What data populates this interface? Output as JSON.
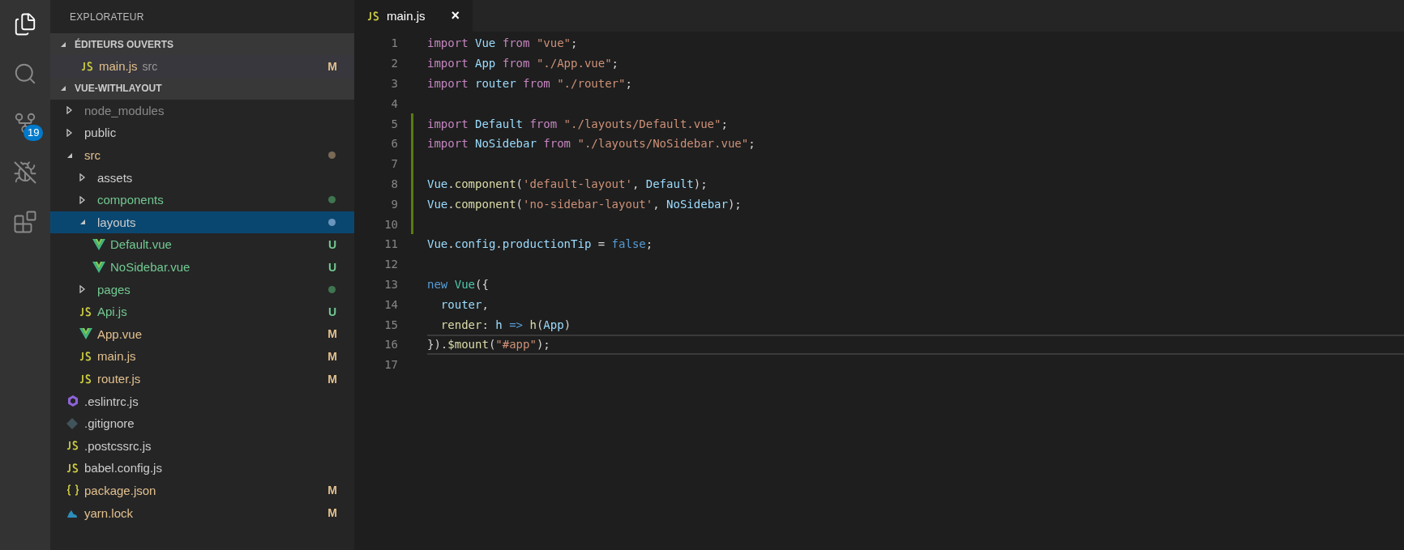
{
  "activity_bar": [
    {
      "kind": "files",
      "selected": true
    },
    {
      "kind": "search",
      "selected": false
    },
    {
      "kind": "branch",
      "selected": false,
      "badge": "19"
    },
    {
      "kind": "debug",
      "selected": false
    },
    {
      "kind": "extensions",
      "selected": false
    }
  ],
  "sidebar": {
    "title": "EXPLORATEUR",
    "open_editors": {
      "title": "ÉDITEURS OUVERTS",
      "expanded": true,
      "items": [
        {
          "kind": "js",
          "name": "main.js",
          "folder": "src",
          "status": "M",
          "modified": true,
          "untracked": false,
          "selected": true
        }
      ]
    },
    "project": {
      "title": "VUE-WITHLAYOUT",
      "expanded": true,
      "items": [
        {
          "kind": "folder",
          "name": "node_modules",
          "expanded": false,
          "ignored": true,
          "modified": false,
          "untracked": false,
          "selected": false
        },
        {
          "kind": "folder",
          "name": "public",
          "expanded": false,
          "ignored": false,
          "modified": false,
          "untracked": false,
          "selected": false
        },
        {
          "kind": "folder",
          "name": "src",
          "expanded": true,
          "ignored": false,
          "modified": true,
          "untracked": false,
          "color": "#7a6a55",
          "selected": false,
          "children": [
            {
              "kind": "folder",
              "name": "assets",
              "expanded": false,
              "ignored": false,
              "modified": false,
              "untracked": false,
              "selected": false
            },
            {
              "kind": "folder",
              "name": "components",
              "expanded": false,
              "ignored": false,
              "modified": false,
              "untracked": true,
              "color": "#3f7550",
              "selected": false
            },
            {
              "kind": "folder",
              "name": "layouts",
              "expanded": true,
              "ignored": false,
              "modified": false,
              "untracked": false,
              "color": "#6a95bd",
              "selected": true,
              "children": [
                {
                  "kind": "vue",
                  "name": "Default.vue",
                  "status": "U",
                  "ignored": false,
                  "modified": false,
                  "untracked": true,
                  "selected": false
                },
                {
                  "kind": "vue",
                  "name": "NoSidebar.vue",
                  "status": "U",
                  "ignored": false,
                  "modified": false,
                  "untracked": true,
                  "selected": false
                }
              ]
            },
            {
              "kind": "folder",
              "name": "pages",
              "expanded": false,
              "ignored": false,
              "modified": false,
              "untracked": true,
              "color": "#3f7550",
              "selected": false
            },
            {
              "kind": "js",
              "name": "Api.js",
              "status": "U",
              "ignored": false,
              "modified": false,
              "untracked": true,
              "selected": false
            },
            {
              "kind": "vue",
              "name": "App.vue",
              "status": "M",
              "ignored": false,
              "modified": true,
              "untracked": false,
              "selected": false
            },
            {
              "kind": "js",
              "name": "main.js",
              "status": "M",
              "ignored": false,
              "modified": true,
              "untracked": false,
              "selected": false
            },
            {
              "kind": "js",
              "name": "router.js",
              "status": "M",
              "ignored": false,
              "modified": true,
              "untracked": false,
              "selected": false
            }
          ]
        },
        {
          "kind": "eslint",
          "name": ".eslintrc.js",
          "ignored": false,
          "modified": false,
          "untracked": false,
          "selected": false
        },
        {
          "kind": "git",
          "name": ".gitignore",
          "ignored": false,
          "modified": false,
          "untracked": false,
          "selected": false
        },
        {
          "kind": "js",
          "name": ".postcssrc.js",
          "ignored": false,
          "modified": false,
          "untracked": false,
          "selected": false
        },
        {
          "kind": "js",
          "name": "babel.config.js",
          "ignored": false,
          "modified": false,
          "untracked": false,
          "selected": false
        },
        {
          "kind": "json",
          "name": "package.json",
          "status": "M",
          "ignored": false,
          "modified": true,
          "untracked": false,
          "selected": false
        },
        {
          "kind": "yarn",
          "name": "yarn.lock",
          "status": "M",
          "ignored": false,
          "modified": true,
          "untracked": false,
          "selected": false
        }
      ]
    }
  },
  "tabs": [
    {
      "kind": "js",
      "label": "main.js",
      "close": "×",
      "selected": true
    }
  ],
  "editor": {
    "lines": [
      {
        "number": "1",
        "added": false,
        "current": false,
        "tokens": [
          {
            "kind": "keyword",
            "text": "import"
          },
          {
            "kind": "variable",
            "text": " Vue"
          },
          {
            "kind": "keyword",
            "text": " from"
          },
          {
            "kind": "string",
            "text": " \"vue\""
          },
          {
            "kind": "plain",
            "text": ";"
          }
        ]
      },
      {
        "number": "2",
        "added": false,
        "current": false,
        "tokens": [
          {
            "kind": "keyword",
            "text": "import"
          },
          {
            "kind": "variable",
            "text": " App"
          },
          {
            "kind": "keyword",
            "text": " from"
          },
          {
            "kind": "string",
            "text": " \"./App.vue\""
          },
          {
            "kind": "plain",
            "text": ";"
          }
        ]
      },
      {
        "number": "3",
        "added": false,
        "current": false,
        "tokens": [
          {
            "kind": "keyword",
            "text": "import"
          },
          {
            "kind": "variable",
            "text": " router"
          },
          {
            "kind": "keyword",
            "text": " from"
          },
          {
            "kind": "string",
            "text": " \"./router\""
          },
          {
            "kind": "plain",
            "text": ";"
          }
        ]
      },
      {
        "number": "4",
        "added": false,
        "current": false
      },
      {
        "number": "5",
        "added": true,
        "current": false,
        "tokens": [
          {
            "kind": "keyword",
            "text": "import"
          },
          {
            "kind": "variable",
            "text": " Default"
          },
          {
            "kind": "keyword",
            "text": " from"
          },
          {
            "kind": "string",
            "text": " \"./layouts/Default.vue\""
          },
          {
            "kind": "plain",
            "text": ";"
          }
        ]
      },
      {
        "number": "6",
        "added": true,
        "current": false,
        "tokens": [
          {
            "kind": "keyword",
            "text": "import"
          },
          {
            "kind": "variable",
            "text": " NoSidebar"
          },
          {
            "kind": "keyword",
            "text": " from"
          },
          {
            "kind": "string",
            "text": " \"./layouts/NoSidebar.vue\""
          },
          {
            "kind": "plain",
            "text": ";"
          }
        ]
      },
      {
        "number": "7",
        "added": true,
        "current": false
      },
      {
        "number": "8",
        "added": true,
        "current": false,
        "tokens": [
          {
            "kind": "variable",
            "text": "Vue"
          },
          {
            "kind": "plain",
            "text": "."
          },
          {
            "kind": "function",
            "text": "component"
          },
          {
            "kind": "plain",
            "text": "("
          },
          {
            "kind": "string",
            "text": "'default-layout'"
          },
          {
            "kind": "plain",
            "text": ","
          },
          {
            "kind": "variable",
            "text": " Default"
          },
          {
            "kind": "plain",
            "text": ");"
          }
        ]
      },
      {
        "number": "9",
        "added": true,
        "current": false,
        "tokens": [
          {
            "kind": "variable",
            "text": "Vue"
          },
          {
            "kind": "plain",
            "text": "."
          },
          {
            "kind": "function",
            "text": "component"
          },
          {
            "kind": "plain",
            "text": "("
          },
          {
            "kind": "string",
            "text": "'no-sidebar-layout'"
          },
          {
            "kind": "plain",
            "text": ","
          },
          {
            "kind": "variable",
            "text": " NoSidebar"
          },
          {
            "kind": "plain",
            "text": ");"
          }
        ]
      },
      {
        "number": "10",
        "added": true,
        "current": false
      },
      {
        "number": "11",
        "added": false,
        "current": false,
        "tokens": [
          {
            "kind": "variable",
            "text": "Vue"
          },
          {
            "kind": "plain",
            "text": "."
          },
          {
            "kind": "variable",
            "text": "config"
          },
          {
            "kind": "plain",
            "text": "."
          },
          {
            "kind": "variable",
            "text": "productionTip"
          },
          {
            "kind": "plain",
            "text": " ="
          },
          {
            "kind": "constant",
            "text": " false"
          },
          {
            "kind": "plain",
            "text": ";"
          }
        ]
      },
      {
        "number": "12",
        "added": false,
        "current": false
      },
      {
        "number": "13",
        "added": false,
        "current": false,
        "tokens": [
          {
            "kind": "constant",
            "text": "new"
          },
          {
            "kind": "class",
            "text": " Vue"
          },
          {
            "kind": "plain",
            "text": "({"
          }
        ]
      },
      {
        "number": "14",
        "added": false,
        "current": false,
        "tokens": [
          {
            "kind": "variable",
            "text": "  router"
          },
          {
            "kind": "plain",
            "text": ","
          }
        ]
      },
      {
        "number": "15",
        "added": false,
        "current": false,
        "tokens": [
          {
            "kind": "function",
            "text": "  render"
          },
          {
            "kind": "plain",
            "text": ":"
          },
          {
            "kind": "variable",
            "text": " h"
          },
          {
            "kind": "constant",
            "text": " =>"
          },
          {
            "kind": "function",
            "text": " h"
          },
          {
            "kind": "plain",
            "text": "("
          },
          {
            "kind": "variable",
            "text": "App"
          },
          {
            "kind": "plain",
            "text": ")"
          }
        ]
      },
      {
        "number": "16",
        "added": false,
        "current": true,
        "tokens": [
          {
            "kind": "plain",
            "text": "})."
          },
          {
            "kind": "function",
            "text": "$mount"
          },
          {
            "kind": "plain",
            "text": "("
          },
          {
            "kind": "string",
            "text": "\"#app\""
          },
          {
            "kind": "plain",
            "text": ");"
          }
        ]
      },
      {
        "number": "17",
        "added": false,
        "current": false
      }
    ]
  }
}
